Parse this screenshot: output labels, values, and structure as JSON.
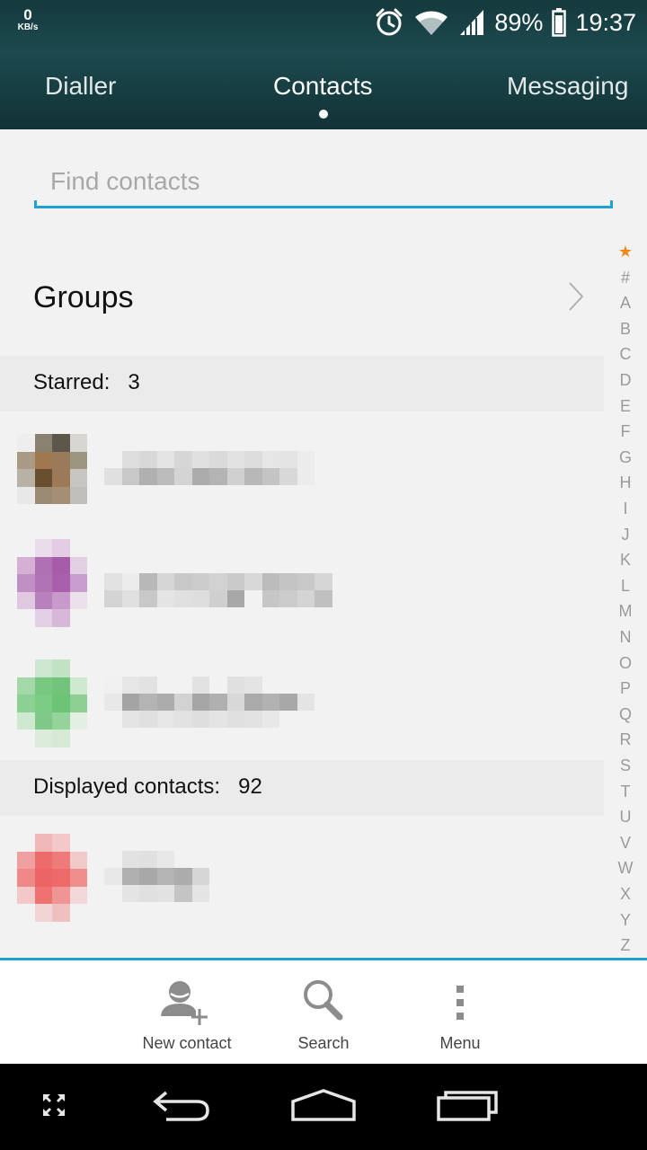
{
  "status_bar": {
    "net_speed_value": "0",
    "net_speed_unit": "KB/s",
    "battery_percent": "89%",
    "time": "19:37",
    "icons": [
      "alarm-icon",
      "wifi-icon",
      "cellular-signal-icon",
      "battery-icon"
    ]
  },
  "tabs": [
    {
      "label": "Dialler"
    },
    {
      "label": "Contacts",
      "selected": true
    },
    {
      "label": "Messaging"
    }
  ],
  "search": {
    "placeholder": "Find contacts",
    "value": ""
  },
  "groups": {
    "label": "Groups"
  },
  "sections": {
    "starred": {
      "label": "Starred:",
      "count": "3"
    },
    "displayed": {
      "label": "Displayed contacts:",
      "count": "92"
    }
  },
  "alphabet": [
    "★",
    "#",
    "A",
    "B",
    "C",
    "D",
    "E",
    "F",
    "G",
    "H",
    "I",
    "J",
    "K",
    "L",
    "M",
    "N",
    "O",
    "P",
    "Q",
    "R",
    "S",
    "T",
    "U",
    "V",
    "W",
    "X",
    "Y",
    "Z"
  ],
  "actions": {
    "new_contact": "New contact",
    "search": "Search",
    "menu": "Menu"
  },
  "colors": {
    "accent": "#1da0d2",
    "header": "#1c4a4e",
    "star": "#f08a1c"
  }
}
